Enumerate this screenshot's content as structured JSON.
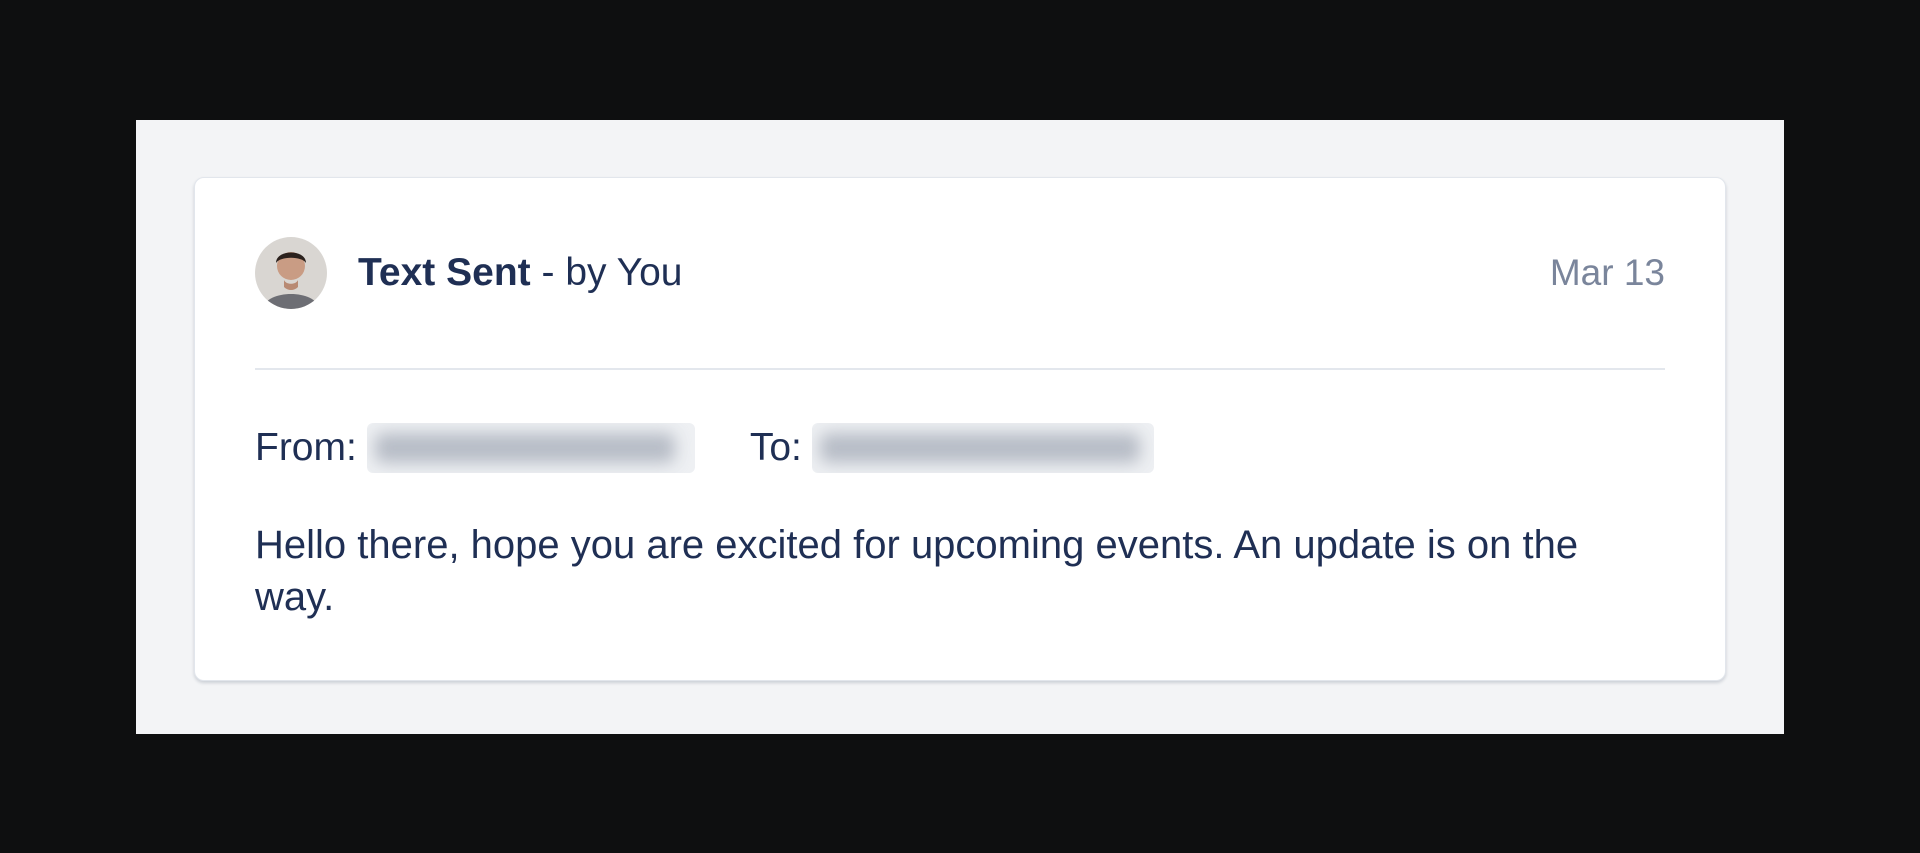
{
  "event": {
    "title_bold": "Text Sent",
    "title_suffix": " - by You",
    "date": "Mar 13"
  },
  "details": {
    "from_label": "From:",
    "to_label": "To:",
    "from_value_redacted": "+1 987-234-233",
    "to_value_redacted": "+1 984-232-232"
  },
  "message": {
    "body": "Hello there, hope you are excited for upcoming events. An update is on the way."
  },
  "icons": {
    "avatar": "user-avatar-photo"
  },
  "colors": {
    "text": "#1f2f54",
    "muted": "#7a859b",
    "divider": "#e3e7ed",
    "background": "#f3f4f6"
  }
}
